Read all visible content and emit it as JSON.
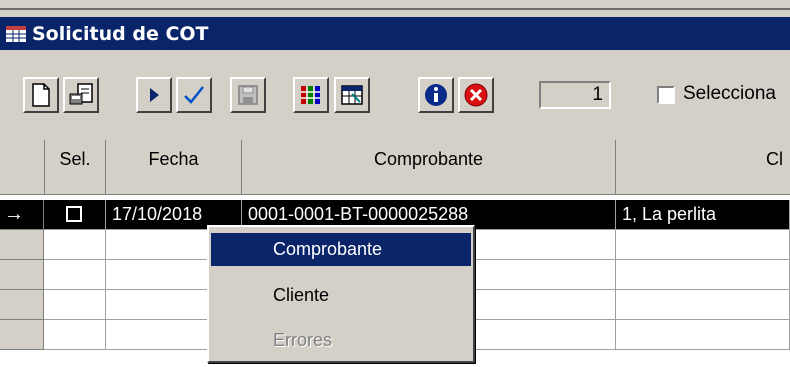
{
  "window": {
    "title": "Solicitud de COT"
  },
  "toolbar": {
    "buttons": [
      "new-document-icon",
      "properties-icon",
      "play-icon",
      "check-icon",
      "save-icon",
      "columns-icon",
      "grid-icon",
      "info-icon",
      "cancel-icon"
    ],
    "counter": "1",
    "select_label": "Selecciona"
  },
  "grid": {
    "columns": {
      "sel": "Sel.",
      "fecha": "Fecha",
      "comprobante": "Comprobante",
      "cliente": "Cl"
    },
    "row": {
      "indicator": "→",
      "fecha": "17/10/2018",
      "comprobante": "0001-0001-BT-0000025288",
      "cliente": "1, La perlita"
    }
  },
  "context_menu": {
    "items": [
      {
        "label": "Comprobante",
        "state": "highlighted"
      },
      {
        "label": "Cliente",
        "state": "enabled"
      },
      {
        "label": "Errores",
        "state": "disabled"
      }
    ]
  },
  "colors": {
    "titlebar": "#0a246a",
    "highlight": "#0a246a",
    "face": "#d4d0c8"
  }
}
